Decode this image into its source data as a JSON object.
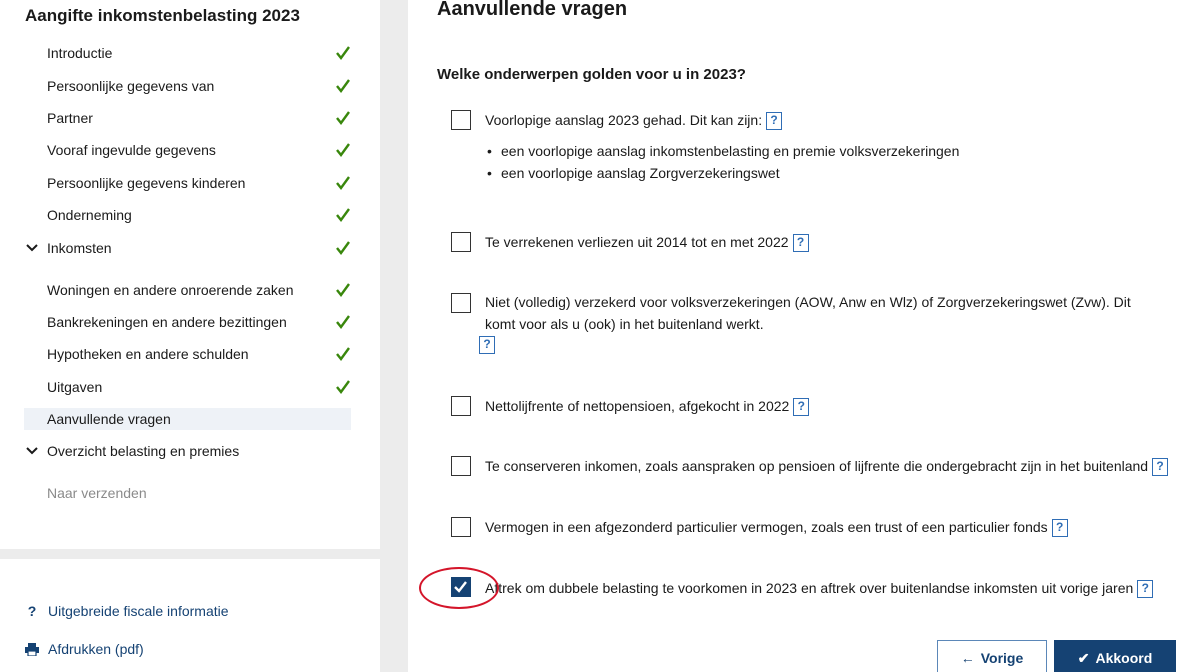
{
  "sidebar": {
    "title": "Aangifte inkomstenbelasting 2023",
    "items": [
      {
        "label": "Introductie",
        "done": true
      },
      {
        "label": "Persoonlijke gegevens van",
        "done": true
      },
      {
        "label": "Partner",
        "done": true
      },
      {
        "label": "Vooraf ingevulde gegevens",
        "done": true
      },
      {
        "label": "Persoonlijke gegevens kinderen",
        "done": true
      },
      {
        "label": "Onderneming",
        "done": true
      },
      {
        "label": "Inkomsten",
        "done": true,
        "expanded": true
      },
      {
        "label": "Woningen en andere onroerende zaken",
        "done": true
      },
      {
        "label": "Bankrekeningen en andere bezittingen",
        "done": true
      },
      {
        "label": "Hypotheken en andere schulden",
        "done": true
      },
      {
        "label": "Uitgaven",
        "done": true
      },
      {
        "label": "Aanvullende vragen",
        "done": false,
        "active": true
      },
      {
        "label": "Overzicht belasting en premies",
        "done": false,
        "expanded": true
      },
      {
        "label": "Naar verzenden",
        "done": false,
        "disabled": true
      }
    ],
    "links": {
      "info": "Uitgebreide fiscale informatie",
      "print": "Afdrukken (pdf)"
    }
  },
  "main": {
    "title": "Aanvullende vragen",
    "question": "Welke onderwerpen golden voor u in 2023?",
    "help_label": "?",
    "options": [
      {
        "label": "Voorlopige aanslag 2023 gehad. Dit kan zijn:",
        "checked": false
      },
      {
        "label": "Te verrekenen verliezen uit 2014 tot en met 2022",
        "checked": false
      },
      {
        "label": "Niet (volledig) verzekerd voor volksverzekeringen (AOW, Anw en Wlz) of Zorgverzekeringswet (Zvw). Dit komt voor als u (ook) in het buitenland werkt.",
        "checked": false
      },
      {
        "label": "Nettolijfrente of nettopensioen, afgekocht in 2022",
        "checked": false
      },
      {
        "label": "Te conserveren inkomen, zoals aanspraken op pensioen of lijfrente die ondergebracht zijn in het buitenland",
        "checked": false
      },
      {
        "label": "Vermogen in een afgezonderd particulier vermogen, zoals een trust of een particulier fonds",
        "checked": false
      },
      {
        "label": "Aftrek om dubbele belasting te voorkomen in 2023 en aftrek over buitenlandse inkomsten uit vorige jaren",
        "checked": true
      }
    ],
    "bullets": [
      "een voorlopige aanslag inkomstenbelasting en premie volksverzekeringen",
      "een voorlopige aanslag Zorgverzekeringswet"
    ]
  },
  "buttons": {
    "prev": "Vorige",
    "ok": "Akkoord"
  },
  "colors": {
    "accent": "#154273",
    "check_green": "#39870c",
    "annotation_red": "#d4152a"
  }
}
